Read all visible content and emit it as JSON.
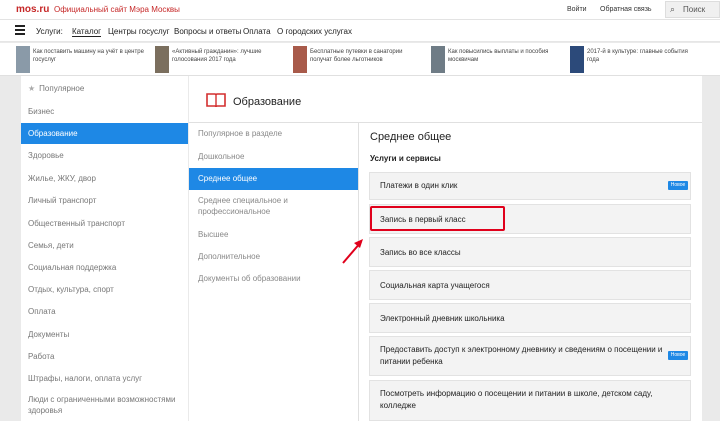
{
  "header": {
    "logo": "mos.ru",
    "site_title": "Официальный сайт Мэра Москвы",
    "login": "Войти",
    "feedback": "Обратная связь",
    "search_label": "Поиск"
  },
  "nav": {
    "services_label": "Услуги:",
    "items": [
      "Каталог",
      "Центры госуслуг",
      "Вопросы и ответы",
      "Оплата",
      "О городских услугах"
    ]
  },
  "news": [
    {
      "text": "Как поставить машину на учёт в центре госуслуг"
    },
    {
      "text": "«Активный гражданин»: лучшие голосования 2017 года"
    },
    {
      "text": "Бесплатные путевки в санатории получат более льготников"
    },
    {
      "text": "Как повысились выплаты и пособия москвичам"
    },
    {
      "text": "2017-й в культуре: главные события года"
    }
  ],
  "left_menu": {
    "items": [
      "Популярное",
      "Бизнес",
      "Образование",
      "Здоровье",
      "Жилье, ЖКУ, двор",
      "Личный транспорт",
      "Общественный транспорт",
      "Семья, дети",
      "Социальная поддержка",
      "Отдых, культура, спорт",
      "Оплата",
      "Документы",
      "Работа",
      "Штрафы, налоги, оплата услуг",
      "Люди с ограниченными возможностями здоровья"
    ]
  },
  "section": {
    "title": "Образование"
  },
  "sub_menu": {
    "items": [
      "Популярное в разделе",
      "Дошкольное",
      "Среднее общее",
      "Среднее специальное и профессиональное",
      "Высшее",
      "Дополнительное",
      "Документы об образовании"
    ]
  },
  "content": {
    "title": "Среднее общее",
    "subtitle": "Услуги и сервисы",
    "badge_new": "Новое",
    "services": [
      "Платежи в один клик",
      "Запись в первый класс",
      "Запись во все классы",
      "Социальная карта учащегося",
      "Электронный дневник школьника",
      "Предоставить доступ к электронному дневнику и сведениям о посещении и питании ребенка",
      "Посмотреть информацию о посещении и питании в школе, детском саду, колледже"
    ]
  },
  "colors": {
    "accent": "#1e88e5",
    "brand": "#c62828",
    "highlight": "#e0001b"
  }
}
